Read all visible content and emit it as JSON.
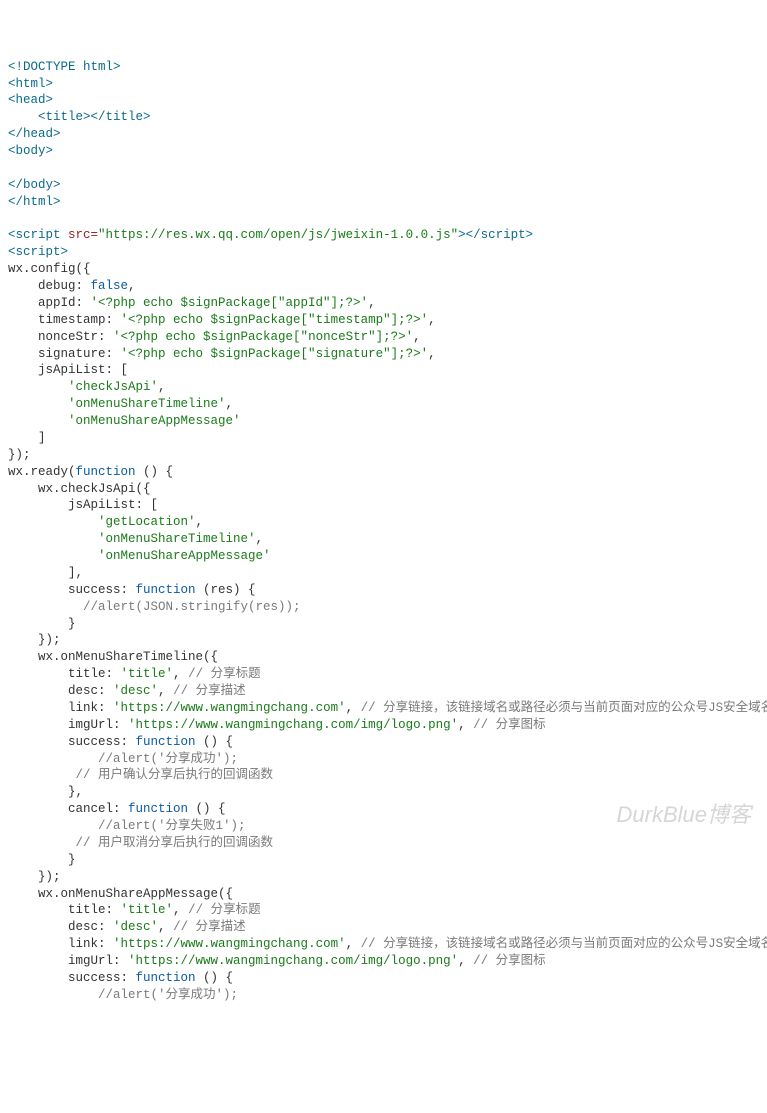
{
  "lines": [
    [
      {
        "c": "tag",
        "t": "<!DOCTYPE html>"
      }
    ],
    [
      {
        "c": "tag",
        "t": "<html>"
      }
    ],
    [
      {
        "c": "tag",
        "t": "<head>"
      }
    ],
    [
      {
        "c": "plain",
        "t": "    "
      },
      {
        "c": "tag",
        "t": "<title>"
      },
      {
        "c": "tag",
        "t": "</title>"
      }
    ],
    [
      {
        "c": "tag",
        "t": "</head>"
      }
    ],
    [
      {
        "c": "tag",
        "t": "<body>"
      }
    ],
    [],
    [
      {
        "c": "tag",
        "t": "</body>"
      }
    ],
    [
      {
        "c": "tag",
        "t": "</html>"
      }
    ],
    [],
    [
      {
        "c": "tag",
        "t": "<script "
      },
      {
        "c": "attr-name",
        "t": "src="
      },
      {
        "c": "attr-value",
        "t": "\"https://res.wx.qq.com/open/js/jweixin-1.0.0.js\""
      },
      {
        "c": "tag",
        "t": ">"
      },
      {
        "c": "tag",
        "t": "</script>"
      }
    ],
    [
      {
        "c": "tag",
        "t": "<script>"
      }
    ],
    [
      {
        "c": "plain",
        "t": "wx.config({"
      }
    ],
    [
      {
        "c": "plain",
        "t": "    debug: "
      },
      {
        "c": "kw",
        "t": "false"
      },
      {
        "c": "plain",
        "t": ","
      }
    ],
    [
      {
        "c": "plain",
        "t": "    appId: "
      },
      {
        "c": "str",
        "t": "'<?php echo $signPackage[\"appId\"];?>'"
      },
      {
        "c": "plain",
        "t": ","
      }
    ],
    [
      {
        "c": "plain",
        "t": "    timestamp: "
      },
      {
        "c": "str",
        "t": "'<?php echo $signPackage[\"timestamp\"];?>'"
      },
      {
        "c": "plain",
        "t": ","
      }
    ],
    [
      {
        "c": "plain",
        "t": "    nonceStr: "
      },
      {
        "c": "str",
        "t": "'<?php echo $signPackage[\"nonceStr\"];?>'"
      },
      {
        "c": "plain",
        "t": ","
      }
    ],
    [
      {
        "c": "plain",
        "t": "    signature: "
      },
      {
        "c": "str",
        "t": "'<?php echo $signPackage[\"signature\"];?>'"
      },
      {
        "c": "plain",
        "t": ","
      }
    ],
    [
      {
        "c": "plain",
        "t": "    jsApiList: ["
      }
    ],
    [
      {
        "c": "plain",
        "t": "        "
      },
      {
        "c": "str",
        "t": "'checkJsApi'"
      },
      {
        "c": "plain",
        "t": ","
      }
    ],
    [
      {
        "c": "plain",
        "t": "        "
      },
      {
        "c": "str",
        "t": "'onMenuShareTimeline'"
      },
      {
        "c": "plain",
        "t": ","
      }
    ],
    [
      {
        "c": "plain",
        "t": "        "
      },
      {
        "c": "str",
        "t": "'onMenuShareAppMessage'"
      }
    ],
    [
      {
        "c": "plain",
        "t": "    ]"
      }
    ],
    [
      {
        "c": "plain",
        "t": "});"
      }
    ],
    [
      {
        "c": "plain",
        "t": "wx.ready("
      },
      {
        "c": "kw",
        "t": "function"
      },
      {
        "c": "plain",
        "t": " () {"
      }
    ],
    [
      {
        "c": "plain",
        "t": "    wx.checkJsApi({"
      }
    ],
    [
      {
        "c": "plain",
        "t": "        jsApiList: ["
      }
    ],
    [
      {
        "c": "plain",
        "t": "            "
      },
      {
        "c": "str",
        "t": "'getLocation'"
      },
      {
        "c": "plain",
        "t": ","
      }
    ],
    [
      {
        "c": "plain",
        "t": "            "
      },
      {
        "c": "str",
        "t": "'onMenuShareTimeline'"
      },
      {
        "c": "plain",
        "t": ","
      }
    ],
    [
      {
        "c": "plain",
        "t": "            "
      },
      {
        "c": "str",
        "t": "'onMenuShareAppMessage'"
      }
    ],
    [
      {
        "c": "plain",
        "t": "        ],"
      }
    ],
    [
      {
        "c": "plain",
        "t": "        success: "
      },
      {
        "c": "kw",
        "t": "function"
      },
      {
        "c": "plain",
        "t": " (res) {"
      }
    ],
    [
      {
        "c": "plain",
        "t": "          "
      },
      {
        "c": "comment",
        "t": "//alert(JSON.stringify(res));"
      }
    ],
    [
      {
        "c": "plain",
        "t": "        }"
      }
    ],
    [
      {
        "c": "plain",
        "t": "    });"
      }
    ],
    [
      {
        "c": "plain",
        "t": "    wx.onMenuShareTimeline({"
      }
    ],
    [
      {
        "c": "plain",
        "t": "        title: "
      },
      {
        "c": "str",
        "t": "'title'"
      },
      {
        "c": "plain",
        "t": ", "
      },
      {
        "c": "comment",
        "t": "// 分享标题"
      }
    ],
    [
      {
        "c": "plain",
        "t": "        desc: "
      },
      {
        "c": "str",
        "t": "'desc'"
      },
      {
        "c": "plain",
        "t": ", "
      },
      {
        "c": "comment",
        "t": "// 分享描述"
      }
    ],
    [
      {
        "c": "plain",
        "t": "        link: "
      },
      {
        "c": "str",
        "t": "'https://www.wangmingchang.com'"
      },
      {
        "c": "plain",
        "t": ", "
      },
      {
        "c": "comment",
        "t": "// 分享链接，该链接域名或路径必须与当前页面对应的公众号JS安全域名一致"
      }
    ],
    [
      {
        "c": "plain",
        "t": "        imgUrl: "
      },
      {
        "c": "str",
        "t": "'https://www.wangmingchang.com/img/logo.png'"
      },
      {
        "c": "plain",
        "t": ", "
      },
      {
        "c": "comment",
        "t": "// 分享图标"
      }
    ],
    [
      {
        "c": "plain",
        "t": "        success: "
      },
      {
        "c": "kw",
        "t": "function"
      },
      {
        "c": "plain",
        "t": " () {"
      }
    ],
    [
      {
        "c": "plain",
        "t": "            "
      },
      {
        "c": "comment",
        "t": "//alert('分享成功');"
      }
    ],
    [
      {
        "c": "plain",
        "t": "         "
      },
      {
        "c": "comment",
        "t": "// 用户确认分享后执行的回调函数"
      }
    ],
    [
      {
        "c": "plain",
        "t": "        },"
      }
    ],
    [
      {
        "c": "plain",
        "t": "        cancel: "
      },
      {
        "c": "kw",
        "t": "function"
      },
      {
        "c": "plain",
        "t": " () {"
      }
    ],
    [
      {
        "c": "plain",
        "t": "            "
      },
      {
        "c": "comment",
        "t": "//alert('分享失败1');"
      }
    ],
    [
      {
        "c": "plain",
        "t": "         "
      },
      {
        "c": "comment",
        "t": "// 用户取消分享后执行的回调函数"
      }
    ],
    [
      {
        "c": "plain",
        "t": "        }"
      }
    ],
    [
      {
        "c": "plain",
        "t": "    });"
      }
    ],
    [
      {
        "c": "plain",
        "t": "    wx.onMenuShareAppMessage({"
      }
    ],
    [
      {
        "c": "plain",
        "t": "        title: "
      },
      {
        "c": "str",
        "t": "'title'"
      },
      {
        "c": "plain",
        "t": ", "
      },
      {
        "c": "comment",
        "t": "// 分享标题"
      }
    ],
    [
      {
        "c": "plain",
        "t": "        desc: "
      },
      {
        "c": "str",
        "t": "'desc'"
      },
      {
        "c": "plain",
        "t": ", "
      },
      {
        "c": "comment",
        "t": "// 分享描述"
      }
    ],
    [
      {
        "c": "plain",
        "t": "        link: "
      },
      {
        "c": "str",
        "t": "'https://www.wangmingchang.com'"
      },
      {
        "c": "plain",
        "t": ", "
      },
      {
        "c": "comment",
        "t": "// 分享链接，该链接域名或路径必须与当前页面对应的公众号JS安全域名一致"
      }
    ],
    [
      {
        "c": "plain",
        "t": "        imgUrl: "
      },
      {
        "c": "str",
        "t": "'https://www.wangmingchang.com/img/logo.png'"
      },
      {
        "c": "plain",
        "t": ", "
      },
      {
        "c": "comment",
        "t": "// 分享图标"
      }
    ],
    [
      {
        "c": "plain",
        "t": "        success: "
      },
      {
        "c": "kw",
        "t": "function"
      },
      {
        "c": "plain",
        "t": " () {"
      }
    ],
    [
      {
        "c": "plain",
        "t": "            "
      },
      {
        "c": "comment",
        "t": "//alert('分享成功');"
      }
    ]
  ],
  "watermark": "DurkBlue博客"
}
